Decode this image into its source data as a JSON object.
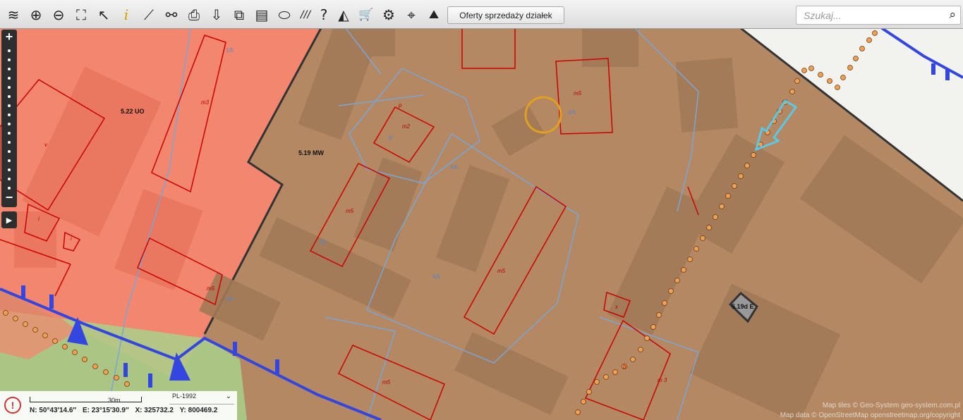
{
  "toolbar": {
    "icons": [
      "layers-icon",
      "zoom-in-icon",
      "zoom-out-icon",
      "zoom-extent-icon",
      "pointer-icon",
      "info-icon",
      "measure-distance-icon",
      "measure-link-icon",
      "print-icon",
      "download-icon",
      "copy-icon",
      "layout-icon",
      "shape-icon",
      "hatch-icon",
      "help-icon",
      "triangle-icon",
      "cart-icon",
      "settings-icon",
      "location-icon",
      "terrain-icon"
    ],
    "glyphs": [
      "≋",
      "⊕",
      "⊖",
      "⛶",
      "↖",
      "i",
      "⟋",
      "⚯",
      "⎙",
      "⇩",
      "⧉",
      "▤",
      "⬭",
      "///",
      "?",
      "◭",
      "🛒",
      "⚙",
      "⌖",
      "⛰"
    ],
    "offers_label": "Oferty sprzedaży działek"
  },
  "search": {
    "placeholder": "Szukaj...",
    "value": ""
  },
  "map": {
    "zones": {
      "uo": "5.22 UO",
      "mw": "5.19 MW",
      "e": "5.19d E"
    },
    "building_labels": [
      "m3",
      "m5",
      "m2",
      "m5",
      "m5",
      "m5",
      "m5",
      "m3",
      "b",
      "x",
      "i",
      "v",
      "p"
    ],
    "colors": {
      "zone_uo": "#f3866e",
      "zone_mw": "#b38863",
      "building_outline": "#cc0000",
      "parcel_line": "#7aa6d6",
      "route_dots": "#f0a050",
      "road": "#f2f2ee",
      "power_line": "#3347e0",
      "highlight_ring": "#e0a020",
      "arrow": "#5bc8e8"
    }
  },
  "zoom": {
    "in": "+",
    "out": "−"
  },
  "side_toggle": "▶",
  "bottom": {
    "scale": "30m",
    "crs": "PL-1992",
    "coords": {
      "n": "N: 50°43′14.6″",
      "e": "E: 23°15′30.9″",
      "x": "X: 325732.2",
      "y": "Y: 800469.2"
    }
  },
  "attribution": {
    "tiles": "Map tiles © Geo-System geo-system.com.pl",
    "data": "Map data © OpenStreetMap openstreetmap.org/copyright"
  }
}
